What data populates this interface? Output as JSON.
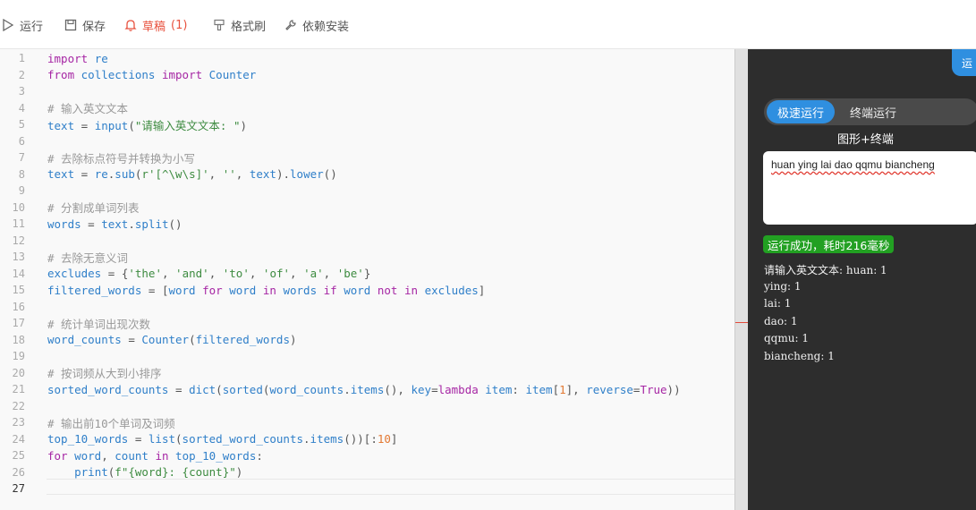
{
  "toolbar": {
    "run_label": "运行",
    "save_label": "保存",
    "draft_label": "草稿",
    "draft_count": "(1)",
    "format_label": "格式刷",
    "deps_label": "依赖安装",
    "draft_color": "#e8523f"
  },
  "editor": {
    "line_numbers": [
      "1",
      "2",
      "3",
      "4",
      "5",
      "6",
      "7",
      "8",
      "9",
      "10",
      "11",
      "12",
      "13",
      "14",
      "15",
      "16",
      "17",
      "18",
      "19",
      "20",
      "21",
      "22",
      "23",
      "24",
      "25",
      "26",
      "27"
    ],
    "lines": [
      "import re",
      "from collections import Counter",
      "",
      "# 输入英文文本",
      "text = input(\"请输入英文文本: \")",
      "",
      "# 去除标点符号并转换为小写",
      "text = re.sub(r'[^\\w\\s]', '', text).lower()",
      "",
      "# 分割成单词列表",
      "words = text.split()",
      "",
      "# 去除无意义词",
      "excludes = {'the', 'and', 'to', 'of', 'a', 'be'}",
      "filtered_words = [word for word in words if word not in excludes]",
      "",
      "# 统计单词出现次数",
      "word_counts = Counter(filtered_words)",
      "",
      "# 按词频从大到小排序",
      "sorted_word_counts = dict(sorted(word_counts.items(), key=lambda item: item[1], reverse=True))",
      "",
      "# 输出前10个单词及词频",
      "top_10_words = list(sorted_word_counts.items())[:10]",
      "for word, count in top_10_words:",
      "    print(f\"{word}: {count}\")",
      ""
    ],
    "current_line": "27"
  },
  "panel": {
    "corner_label": "运",
    "mode_fast": "极速运行",
    "mode_terminal": "终端运行",
    "mode_gui": "图形+终端",
    "input_value": "huan ying lai dao qqmu biancheng",
    "status": "运行成功，耗时216毫秒",
    "output": [
      "请输入英文文本: huan: 1",
      "ying: 1",
      "lai: 1",
      "dao: 1",
      "qqmu: 1",
      "biancheng: 1"
    ],
    "accent_color": "#2f8fe0",
    "status_color": "#22a022"
  }
}
